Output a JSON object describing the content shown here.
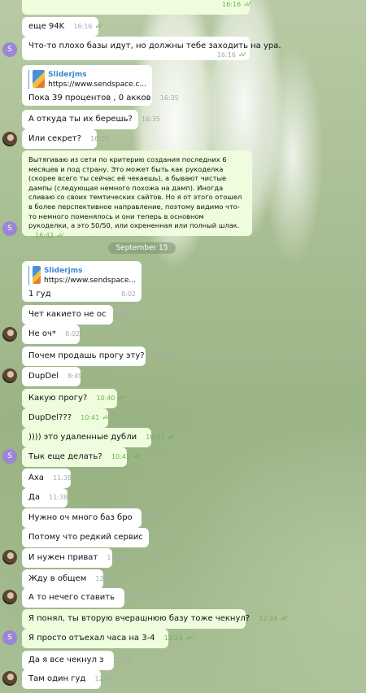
{
  "chat": {
    "date_separator": "September 15",
    "messages": [
      {
        "dir": "out",
        "text": "",
        "time": "16:16",
        "status": "read"
      },
      {
        "dir": "out",
        "text": "еще 94K",
        "time": "16:16",
        "status": "read"
      },
      {
        "dir": "in",
        "avatar": "S",
        "text": "Что-то плохо базы идут, но должны тебе заходить на ура.",
        "time": "16:16",
        "status": "read"
      },
      {
        "dir": "in",
        "link": {
          "title": "Sliderjms",
          "url": "https://www.sendspace.c..."
        },
        "text": "Пока 39 процентов , 0 акков",
        "time": "16:35"
      },
      {
        "dir": "in",
        "text": "А откуда ты их берешь?",
        "time": "16:35"
      },
      {
        "dir": "in",
        "avatar": "photo",
        "text": "Или секрет?",
        "time": "16:35"
      },
      {
        "dir": "out",
        "avatar": "S",
        "text": "Вытягиваю из сети по критерию создания последних 6 месяцев и под страну. Это может быть как рукоделка (скорее всего ты сейчас её чекаешь), а бывают чистые дампы (следующая немного похожа на дамп). Иногда сливаю со своих темтических сайтов. Но я от этого отошел в более перспективное направление, поэтому видимо что-то немного поменялось и они теперь в основном рукоделки, а это 50/50, или охрененная или полный шлак.",
        "time": "16:42",
        "status": "read"
      },
      {
        "dir": "in",
        "link": {
          "title": "Sliderjms",
          "url": "https://www.sendspace..."
        },
        "text": "1 гуд",
        "time": "8:02"
      },
      {
        "dir": "in",
        "text": "Чет какието не ос",
        "time": "8:02"
      },
      {
        "dir": "in",
        "avatar": "photo",
        "text": "Не оч*",
        "time": "8:02"
      },
      {
        "dir": "in",
        "text": "Почем продашь прогу эту?",
        "time": "8:49"
      },
      {
        "dir": "in",
        "avatar": "photo",
        "text": "DupDel",
        "time": "8:49"
      },
      {
        "dir": "out",
        "text": "Какую прогу?",
        "time": "10:40",
        "status": "read"
      },
      {
        "dir": "out",
        "text": "DupDel???",
        "time": "10:41",
        "status": "read"
      },
      {
        "dir": "out",
        "text": ")))) это удаленные дубли",
        "time": "10:41",
        "status": "read"
      },
      {
        "dir": "out",
        "avatar": "S",
        "text": "Тык еще делать?",
        "time": "10:41",
        "status": "read"
      },
      {
        "dir": "in",
        "text": "Аха",
        "time": "11:38"
      },
      {
        "dir": "in",
        "text": "Да",
        "time": "11:38"
      },
      {
        "dir": "in",
        "text": "Нужно оч много баз бро",
        "time": "11:38"
      },
      {
        "dir": "in",
        "text": "Потому что редкий сервис",
        "time": "11:38"
      },
      {
        "dir": "in",
        "avatar": "photo",
        "text": "И нужен приват",
        "time": "11:38"
      },
      {
        "dir": "in",
        "text": "Жду в общем",
        "time": "12:20"
      },
      {
        "dir": "in",
        "avatar": "photo",
        "text": "А то нечего ставить",
        "time": "12:20"
      },
      {
        "dir": "out",
        "text": "Я понял, ты вторую вчерашнюю базу тоже чекнул?",
        "time": "12:24",
        "status": "read"
      },
      {
        "dir": "out",
        "avatar": "S",
        "text": "Я просто отъехал часа на 3-4",
        "time": "12:24",
        "status": "read"
      },
      {
        "dir": "in",
        "text": "Да я все чекнул з",
        "time": "12:24"
      },
      {
        "dir": "in",
        "avatar": "photo",
        "text": "Там один гуд",
        "time": "12:24"
      }
    ]
  }
}
